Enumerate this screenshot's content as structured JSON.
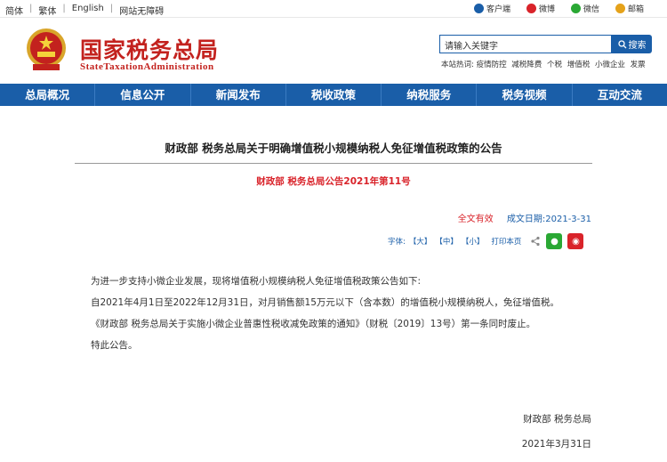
{
  "topbar": {
    "links": [
      "简体",
      "繁体",
      "English",
      "网站无障碍"
    ],
    "right": [
      {
        "label": "客户端",
        "icon": "mobile-icon",
        "color": "#1a5ea8"
      },
      {
        "label": "微博",
        "icon": "weibo-icon",
        "color": "#d9232a"
      },
      {
        "label": "微信",
        "icon": "wechat-icon",
        "color": "#2aa834"
      },
      {
        "label": "邮箱",
        "icon": "mail-icon",
        "color": "#e5a21a"
      }
    ]
  },
  "header": {
    "site_name": "国家税务总局",
    "site_name_en": "StateTaxationAdministration",
    "search_placeholder": "请输入关键字",
    "search_button": "搜索",
    "hot_label": "本站热词:",
    "hot_words": [
      "疫情防控",
      "减税降费",
      "个税",
      "增值税",
      "小微企业",
      "发票"
    ]
  },
  "nav": [
    "总局概况",
    "信息公开",
    "新闻发布",
    "税收政策",
    "纳税服务",
    "税务视频",
    "互动交流"
  ],
  "article": {
    "title": "财政部 税务总局关于明确增值税小规模纳税人免征增值税政策的公告",
    "subtitle": "财政部 税务总局公告2021年第11号",
    "validity": "全文有效",
    "date": "成文日期:2021-3-31",
    "font_label": "字体:",
    "font_sizes": [
      "【大】",
      "【中】",
      "【小】"
    ],
    "print_label": "打印本页",
    "paragraphs": [
      "为进一步支持小微企业发展，现将增值税小规模纳税人免征增值税政策公告如下:",
      "自2021年4月1日至2022年12月31日，对月销售额15万元以下（含本数）的增值税小规模纳税人，免征增值税。",
      "《财政部 税务总局关于实施小微企业普惠性税收减免政策的通知》（财税〔2019〕13号）第一条同时废止。",
      "特此公告。"
    ],
    "signer": "财政部 税务总局",
    "sign_date": "2021年3月31日"
  },
  "colors": {
    "brand": "#c3221e",
    "nav": "#1a5ea8",
    "accent": "#d9232a"
  }
}
